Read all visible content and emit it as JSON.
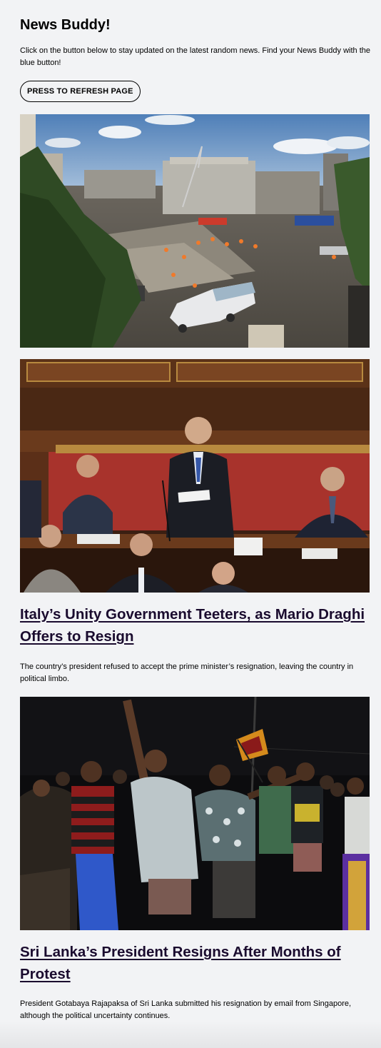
{
  "header": {
    "title": "News Buddy!",
    "intro": "Click on the button below to stay updated on the latest random news. Find your News Buddy with the blue button!",
    "refresh_label": "PRESS TO REFRESH PAGE"
  },
  "articles": [
    {
      "headline": "",
      "summary": ""
    },
    {
      "headline": "Italy’s Unity Government Teeters, as Mario Draghi Offers to Resign",
      "summary": "The country’s president refused to accept the prime minister’s resignation, leaving the country in political limbo."
    },
    {
      "headline": "Sri Lanka’s President Resigns After Months of Protest",
      "summary": "President Gotabaya Rajapaksa of Sri Lanka submitted his resignation by email from Singapore, although the political uncertainty continues."
    }
  ],
  "colors": {
    "background": "#f2f3f5",
    "headline_link": "#1a0b2e"
  }
}
